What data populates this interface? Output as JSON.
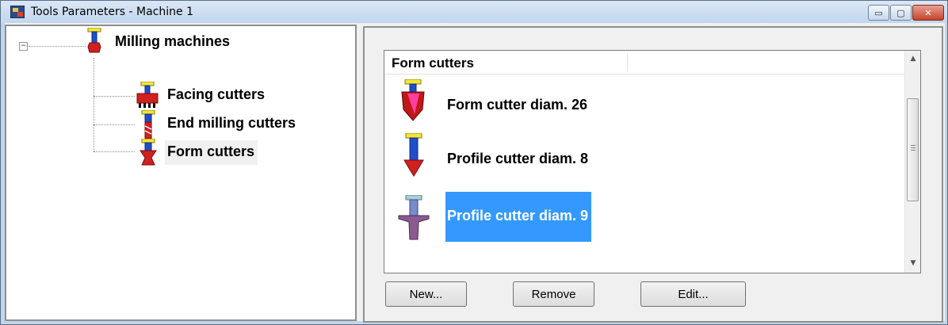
{
  "window": {
    "title": "Tools Parameters - Machine 1",
    "minimize_glyph": "▭",
    "maximize_glyph": "▢",
    "close_glyph": "✕"
  },
  "tree": {
    "expander_glyph": "−",
    "root_label": "Milling machines",
    "children": [
      {
        "label": "Facing cutters",
        "icon": "facing-cutter-icon"
      },
      {
        "label": "End milling cutters",
        "icon": "end-mill-icon"
      },
      {
        "label": "Form cutters",
        "icon": "form-cutter-icon",
        "selected": true
      }
    ]
  },
  "list": {
    "column_header": "Form cutters",
    "items": [
      {
        "label": "Form cutter diam. 26",
        "icon": "form-cutter-icon"
      },
      {
        "label": "Profile cutter diam. 8",
        "icon": "profile-cutter-icon"
      },
      {
        "label": "Profile cutter diam. 9",
        "icon": "profile-cutter-icon",
        "selected": true
      }
    ]
  },
  "buttons": {
    "new": "New...",
    "remove": "Remove",
    "edit": "Edit..."
  },
  "colors": {
    "selection": "#3399ff",
    "title_bar": "#c2d6ee"
  }
}
